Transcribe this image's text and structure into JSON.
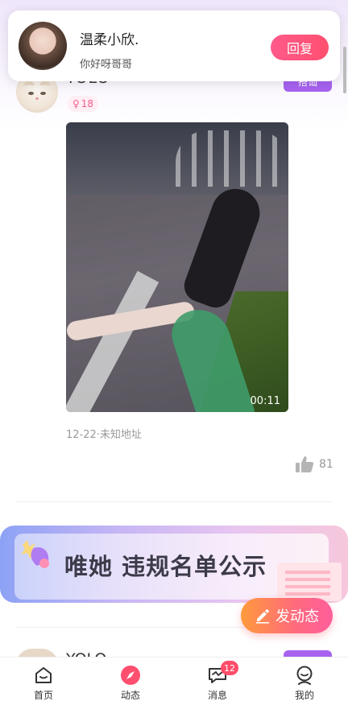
{
  "notification": {
    "name": "温柔小欣.",
    "message": "你好呀哥哥",
    "reply_label": "回复"
  },
  "post1": {
    "username": "YOLO",
    "tag": "搭讪",
    "age": "18",
    "duration": "00:11",
    "meta": "12-22·未知地址",
    "likes": "81"
  },
  "banner": {
    "text": "唯她  违规名单公示"
  },
  "fab": {
    "label": "发动态"
  },
  "post2": {
    "username": "YOLO"
  },
  "nav": {
    "items": [
      {
        "label": "首页",
        "icon": "home-icon"
      },
      {
        "label": "动态",
        "icon": "feed-icon",
        "active": true
      },
      {
        "label": "消息",
        "icon": "message-icon",
        "badge": "12"
      },
      {
        "label": "我的",
        "icon": "profile-icon"
      }
    ]
  },
  "colors": {
    "accent_pink": "#ff4f6f",
    "tag_purple": "#a763f0",
    "fab_gradient_start": "#ff9a3c",
    "fab_gradient_end": "#ff5e9c"
  }
}
